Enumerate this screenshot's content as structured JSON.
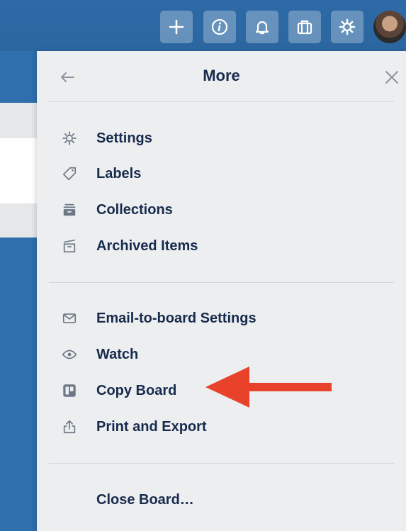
{
  "header": {
    "buttons": [
      {
        "name": "add-icon"
      },
      {
        "name": "info-icon"
      },
      {
        "name": "bell-icon"
      },
      {
        "name": "briefcase-icon"
      },
      {
        "name": "gear-icon"
      }
    ]
  },
  "panel": {
    "title": "More",
    "groups": [
      [
        {
          "label": "Settings",
          "icon": "gear-icon"
        },
        {
          "label": "Labels",
          "icon": "tag-icon"
        },
        {
          "label": "Collections",
          "icon": "collection-icon"
        },
        {
          "label": "Archived Items",
          "icon": "archive-icon"
        }
      ],
      [
        {
          "label": "Email-to-board Settings",
          "icon": "email-icon"
        },
        {
          "label": "Watch",
          "icon": "eye-icon"
        },
        {
          "label": "Copy Board",
          "icon": "board-icon"
        },
        {
          "label": "Print and Export",
          "icon": "share-icon"
        }
      ],
      [
        {
          "label": "Close Board…"
        }
      ]
    ]
  },
  "annotation": {
    "color": "#e8432a"
  }
}
